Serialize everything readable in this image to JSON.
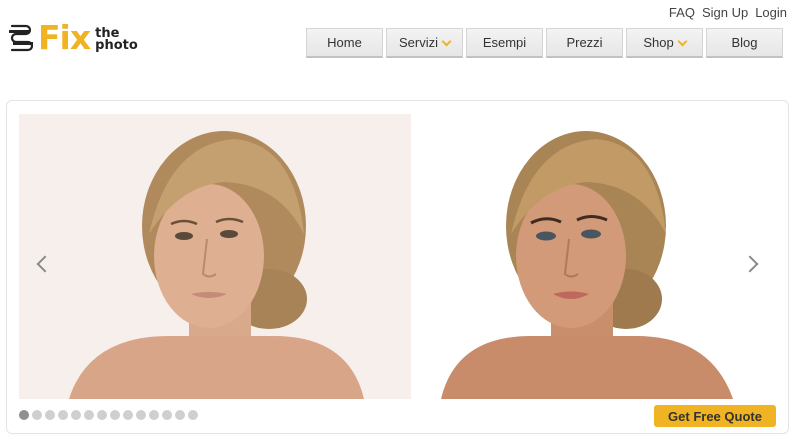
{
  "logo": {
    "word": "Fix",
    "line1": "the",
    "line2": "photo"
  },
  "top_links": [
    "FAQ",
    "Sign Up",
    "Login"
  ],
  "nav": [
    {
      "label": "Home",
      "dropdown": false
    },
    {
      "label": "Servizi",
      "dropdown": true
    },
    {
      "label": "Esempi",
      "dropdown": false
    },
    {
      "label": "Prezzi",
      "dropdown": false
    },
    {
      "label": "Shop",
      "dropdown": true
    },
    {
      "label": "Blog",
      "dropdown": false
    }
  ],
  "slider": {
    "slide_count": 14,
    "active_slide": 1,
    "cta_label": "Get Free Quote",
    "prev_icon": "chevron-left-icon",
    "next_icon": "chevron-right-icon"
  },
  "colors": {
    "accent": "#f0b323",
    "text": "#333333"
  }
}
